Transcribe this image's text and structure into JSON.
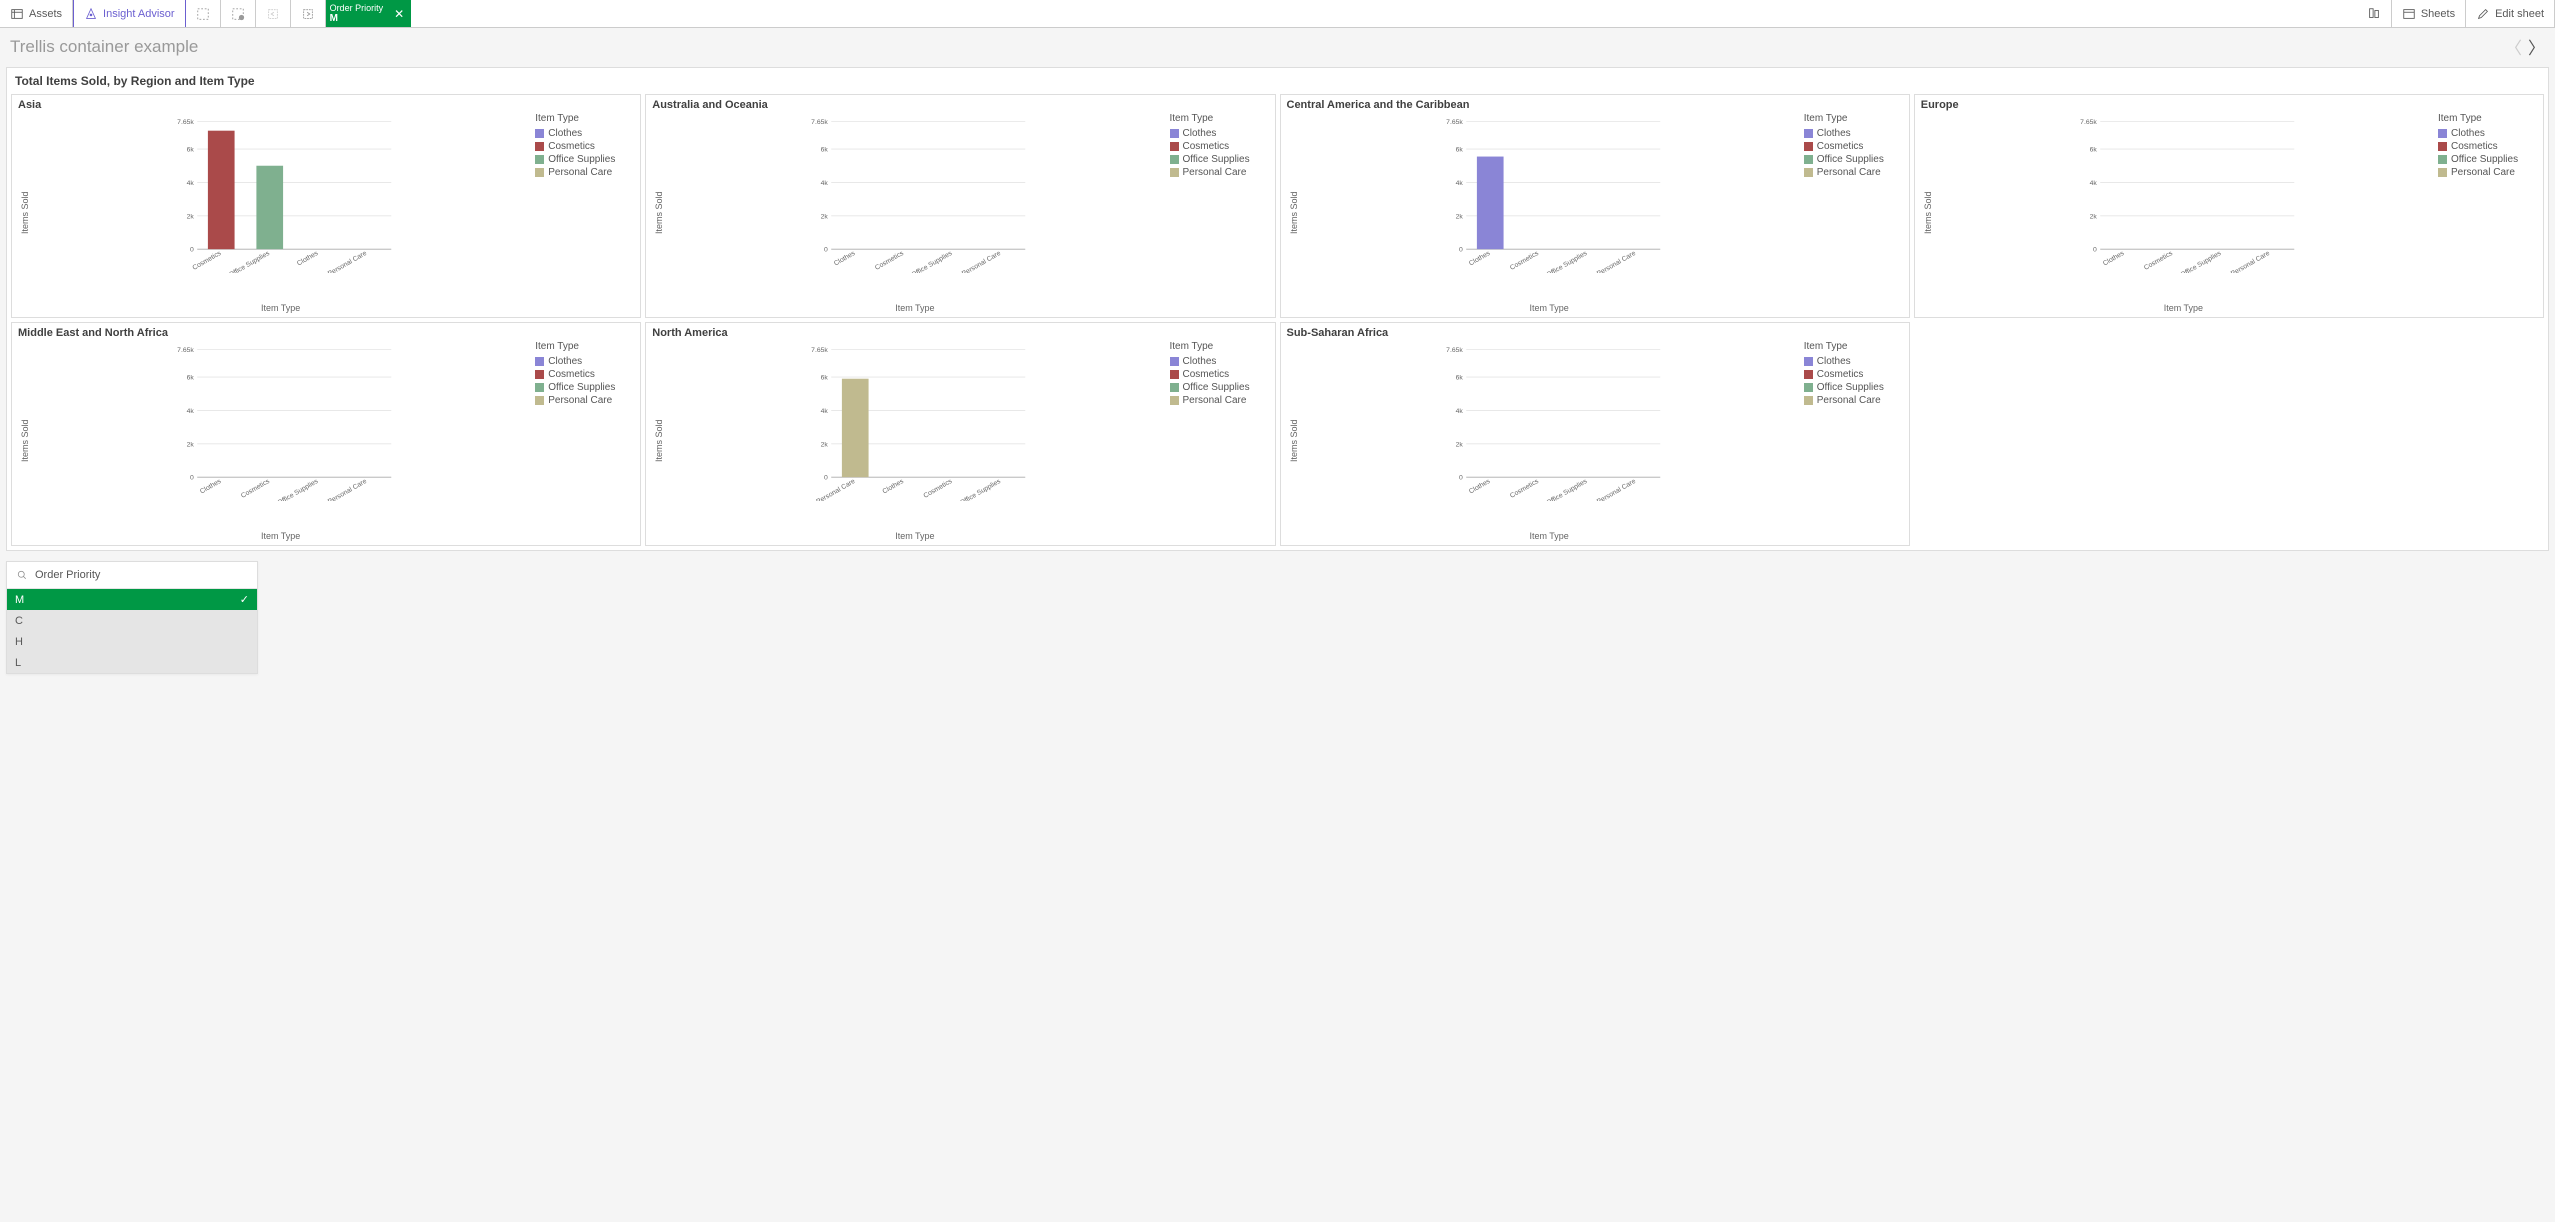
{
  "toolbar": {
    "assets": "Assets",
    "insight": "Insight Advisor",
    "sheets": "Sheets",
    "edit": "Edit sheet",
    "selection_tag": {
      "field": "Order Priority",
      "value": "M"
    }
  },
  "sheet": {
    "title": "Trellis container example"
  },
  "panel_title": "Total Items Sold, by Region and Item Type",
  "legend_title": "Item Type",
  "legend_items": [
    "Clothes",
    "Cosmetics",
    "Office Supplies",
    "Personal Care"
  ],
  "colors": {
    "Clothes": "#8a85d6",
    "Cosmetics": "#aa4a4a",
    "Office Supplies": "#7fb08f",
    "Personal Care": "#c0ba8f"
  },
  "axis": {
    "ylabel": "Items Sold",
    "xlabel": "Item Type",
    "ticks": [
      0,
      2000,
      4000,
      6000,
      7650
    ],
    "tick_labels": [
      "0",
      "2k",
      "4k",
      "6k",
      "7.65k"
    ],
    "ymax": 7650
  },
  "filter": {
    "icon": "search",
    "title": "Order Priority",
    "options": [
      "M",
      "C",
      "H",
      "L"
    ],
    "selected": "M"
  },
  "chart_data": [
    {
      "region": "Asia",
      "type": "bar",
      "categories": [
        "Cosmetics",
        "Office Supplies",
        "Clothes",
        "Personal Care"
      ],
      "values": [
        7100,
        5000,
        0,
        0
      ]
    },
    {
      "region": "Australia and Oceania",
      "type": "bar",
      "categories": [
        "Clothes",
        "Cosmetics",
        "Office Supplies",
        "Personal Care"
      ],
      "values": [
        0,
        0,
        0,
        0
      ]
    },
    {
      "region": "Central America and the Caribbean",
      "type": "bar",
      "categories": [
        "Clothes",
        "Cosmetics",
        "Office Supplies",
        "Personal Care"
      ],
      "values": [
        5550,
        0,
        0,
        0
      ]
    },
    {
      "region": "Europe",
      "type": "bar",
      "categories": [
        "Clothes",
        "Cosmetics",
        "Office Supplies",
        "Personal Care"
      ],
      "values": [
        0,
        0,
        0,
        0
      ]
    },
    {
      "region": "Middle East and North Africa",
      "type": "bar",
      "categories": [
        "Clothes",
        "Cosmetics",
        "Office Supplies",
        "Personal Care"
      ],
      "values": [
        0,
        0,
        0,
        0
      ]
    },
    {
      "region": "North America",
      "type": "bar",
      "categories": [
        "Personal Care",
        "Clothes",
        "Cosmetics",
        "Office Supplies"
      ],
      "values": [
        5900,
        0,
        0,
        0
      ]
    },
    {
      "region": "Sub-Saharan Africa",
      "type": "bar",
      "categories": [
        "Clothes",
        "Cosmetics",
        "Office Supplies",
        "Personal Care"
      ],
      "values": [
        0,
        0,
        0,
        0
      ]
    }
  ]
}
